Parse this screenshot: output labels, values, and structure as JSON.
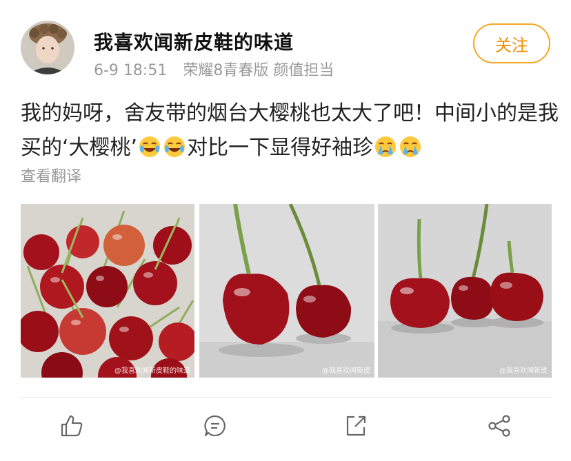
{
  "post": {
    "username": "我喜欢闻新皮鞋的味道",
    "date": "6-9 18:51",
    "device": "荣耀8青春版 颜值担当",
    "follow_label": "关注",
    "text_part1": "我的妈呀，舍友带的烟台大樱桃也太大了吧！中间小的是我买的‘大樱桃’",
    "text_part2": "对比一下显得好袖珍",
    "translate_label": "查看翻译"
  },
  "photos": [
    {
      "watermark": "@我喜欢闻新皮鞋的味道"
    },
    {
      "watermark": "@我喜欢闻新皮"
    },
    {
      "watermark": "@我喜欢闻新皮"
    }
  ],
  "actions": [
    "like-icon",
    "comment-icon",
    "share-icon",
    "more-share-icon"
  ],
  "colors": {
    "accent": "#f6a623",
    "meta": "#9a9a9a",
    "cherry": "#a3121c"
  }
}
